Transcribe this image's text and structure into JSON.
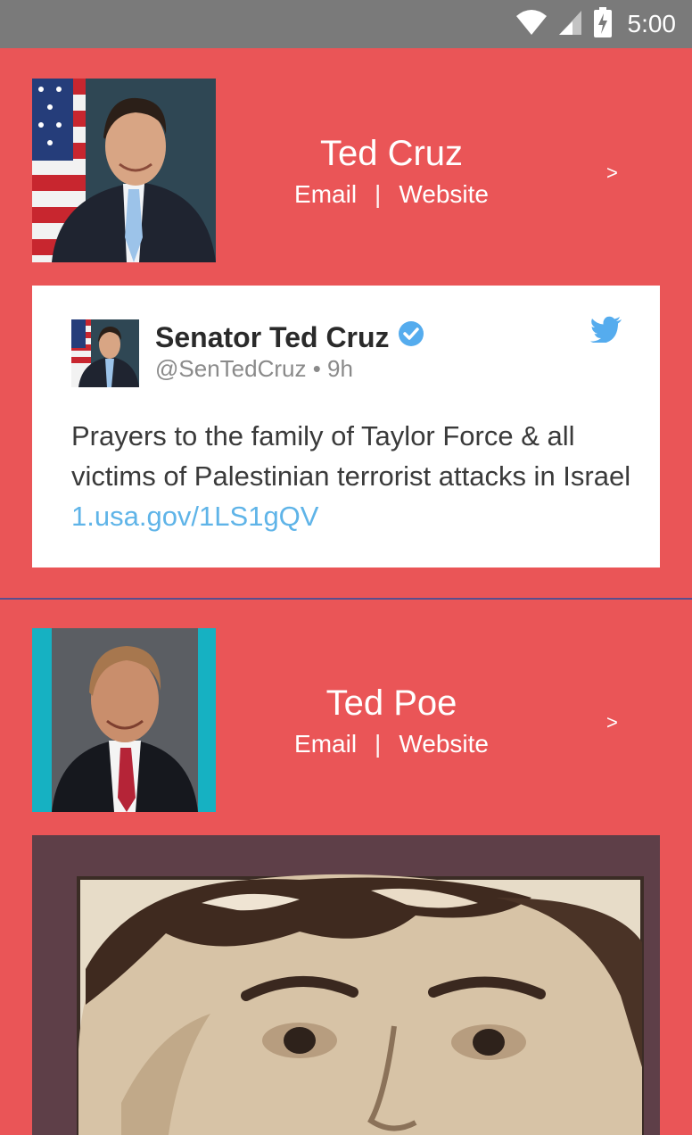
{
  "status_bar": {
    "time": "5:00",
    "icons": [
      "wifi-icon",
      "signal-icon",
      "battery-charging-icon"
    ]
  },
  "colors": {
    "background": "#ea5557",
    "status_bar": "#7a7a7a",
    "tweet_link": "#5fb4e8",
    "twitter_blue": "#55acee",
    "divider": "#5a4e8e"
  },
  "members": [
    {
      "name": "Ted Cruz",
      "email_label": "Email",
      "separator": "|",
      "website_label": "Website",
      "chevron": ">",
      "tweet": {
        "author": "Senator Ted Cruz",
        "handle": "@SenTedCruz",
        "time": "9h",
        "text": "Prayers to the family of Taylor Force & all victims of Palestinian terrorist attacks in Israel ",
        "link": "1.usa.gov/1LS1gQV"
      }
    },
    {
      "name": "Ted Poe",
      "email_label": "Email",
      "separator": "|",
      "website_label": "Website",
      "chevron": ">"
    }
  ]
}
